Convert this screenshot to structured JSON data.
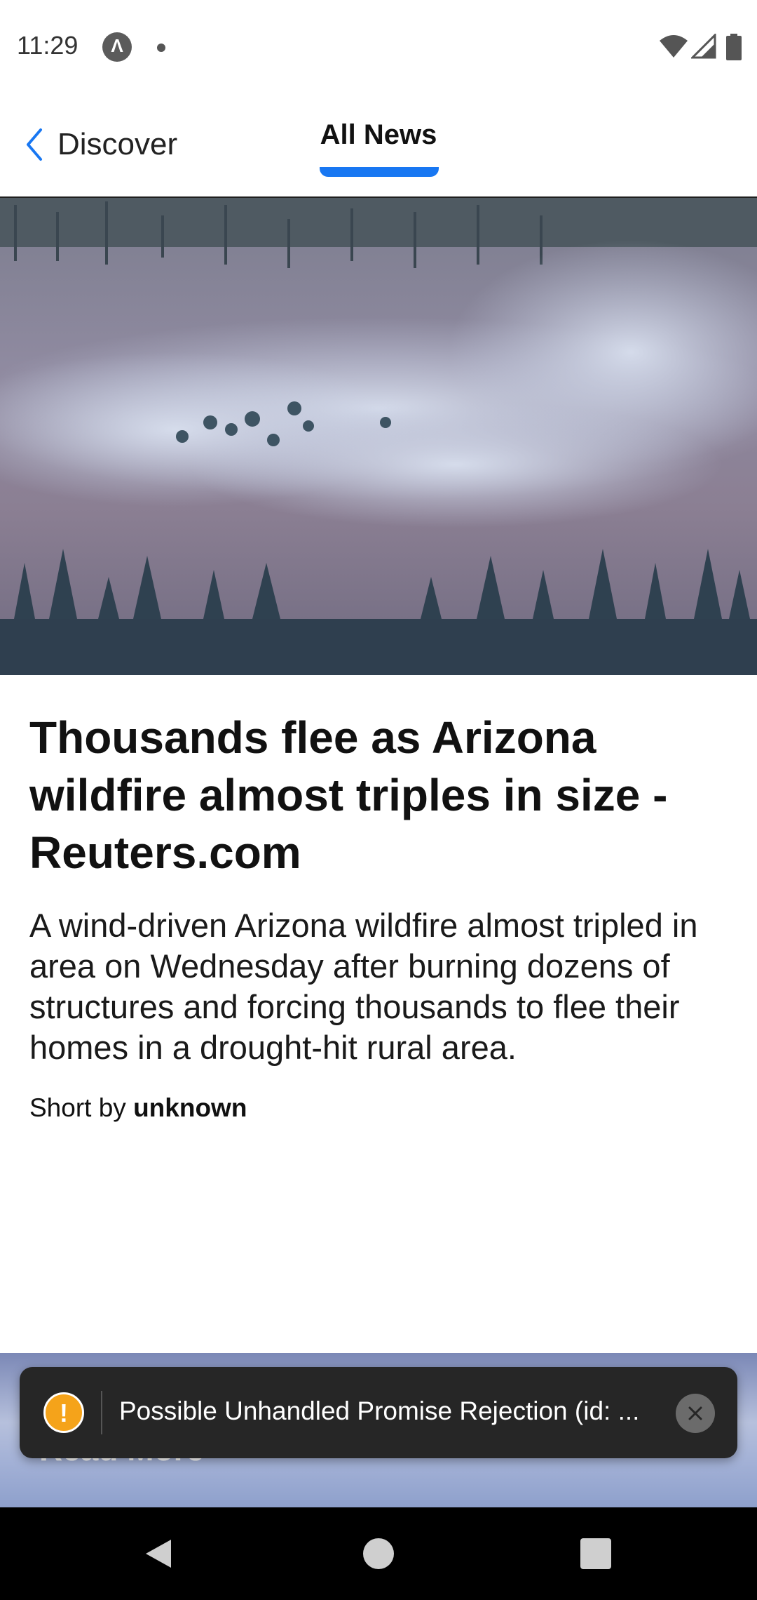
{
  "status_bar": {
    "time": "11:29",
    "app_icon_glyph": "Λ",
    "icons": [
      "app-notification-icon",
      "dot-icon",
      "wifi-icon",
      "signal-icon",
      "battery-icon"
    ]
  },
  "header": {
    "back_label": "Discover",
    "back_icon": "chevron-left-icon",
    "active_tab": "All News",
    "accent_color": "#1877f2"
  },
  "article": {
    "image_description_icon": "wildfire-photo",
    "headline": "Thousands flee as Arizona wildfire almost triples in size - Reuters.com",
    "summary": "A wind-driven Arizona wildfire almost tripled in area on Wednesday after burning dozens of structures and forcing thousands to flee their homes in a drought-hit rural area.",
    "byline_prefix": "Short by",
    "byline_author": "unknown"
  },
  "read_more": {
    "label": "Read More"
  },
  "toast": {
    "icon_glyph": "!",
    "message": "Possible Unhandled Promise Rejection (id: ...",
    "warning_color": "#f5a31a"
  },
  "nav_bar": {
    "icons": [
      "nav-back-icon",
      "nav-home-icon",
      "nav-recents-icon"
    ]
  }
}
